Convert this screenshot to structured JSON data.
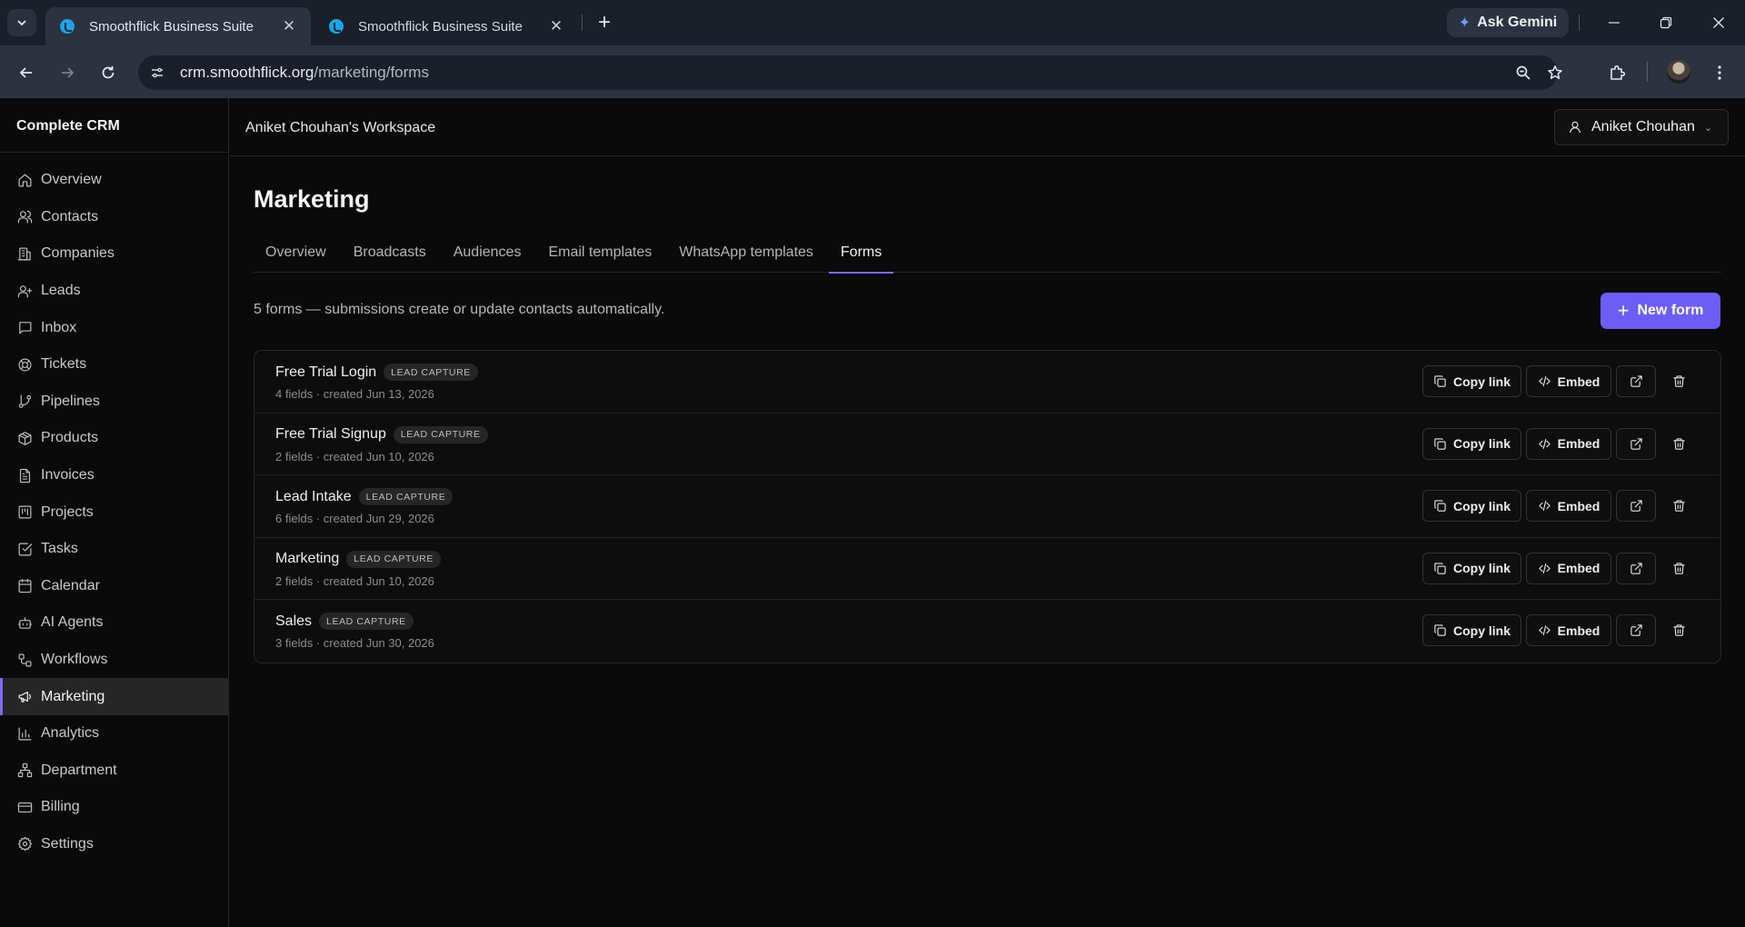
{
  "browser": {
    "tabs": [
      {
        "title": "Smoothflick Business Suite",
        "active": true
      },
      {
        "title": "Smoothflick Business Suite",
        "active": false
      }
    ],
    "new_tab": "+",
    "gemini_label": "Ask Gemini",
    "url_host": "crm.smoothflick.org",
    "url_path": "/marketing/forms"
  },
  "app": {
    "brand": "Complete CRM",
    "workspace": "Aniket Chouhan's Workspace",
    "user_name": "Aniket Chouhan"
  },
  "sidebar": {
    "items": [
      {
        "label": "Overview",
        "icon": "home-icon"
      },
      {
        "label": "Contacts",
        "icon": "users-icon"
      },
      {
        "label": "Companies",
        "icon": "building-icon"
      },
      {
        "label": "Leads",
        "icon": "user-plus-icon"
      },
      {
        "label": "Inbox",
        "icon": "message-icon"
      },
      {
        "label": "Tickets",
        "icon": "lifebuoy-icon"
      },
      {
        "label": "Pipelines",
        "icon": "git-branch-icon"
      },
      {
        "label": "Products",
        "icon": "package-icon"
      },
      {
        "label": "Invoices",
        "icon": "file-text-icon"
      },
      {
        "label": "Projects",
        "icon": "kanban-icon"
      },
      {
        "label": "Tasks",
        "icon": "check-square-icon"
      },
      {
        "label": "Calendar",
        "icon": "calendar-icon"
      },
      {
        "label": "AI Agents",
        "icon": "bot-icon"
      },
      {
        "label": "Workflows",
        "icon": "workflow-icon"
      },
      {
        "label": "Marketing",
        "icon": "megaphone-icon",
        "active": true
      },
      {
        "label": "Analytics",
        "icon": "bar-chart-icon"
      },
      {
        "label": "Department",
        "icon": "network-icon"
      },
      {
        "label": "Billing",
        "icon": "credit-card-icon"
      },
      {
        "label": "Settings",
        "icon": "gear-icon"
      }
    ]
  },
  "page": {
    "title": "Marketing",
    "tabs": [
      "Overview",
      "Broadcasts",
      "Audiences",
      "Email templates",
      "WhatsApp templates",
      "Forms"
    ],
    "active_tab": "Forms",
    "summary": "5 forms — submissions create or update contacts automatically.",
    "new_form_label": "New form"
  },
  "forms": [
    {
      "name": "Free Trial Login",
      "badge": "LEAD CAPTURE",
      "meta": "4 fields · created Jun 13, 2026"
    },
    {
      "name": "Free Trial Signup",
      "badge": "LEAD CAPTURE",
      "meta": "2 fields · created Jun 10, 2026"
    },
    {
      "name": "Lead Intake",
      "badge": "LEAD CAPTURE",
      "meta": "6 fields · created Jun 29, 2026"
    },
    {
      "name": "Marketing",
      "badge": "LEAD CAPTURE",
      "meta": "2 fields · created Jun 10, 2026"
    },
    {
      "name": "Sales",
      "badge": "LEAD CAPTURE",
      "meta": "3 fields · created Jun 30, 2026"
    }
  ],
  "actions": {
    "copy_link": "Copy link",
    "embed": "Embed"
  },
  "colors": {
    "accent": "#7c6cf7",
    "primary_button": "#6e5cf6",
    "background": "#0a0a0a"
  }
}
